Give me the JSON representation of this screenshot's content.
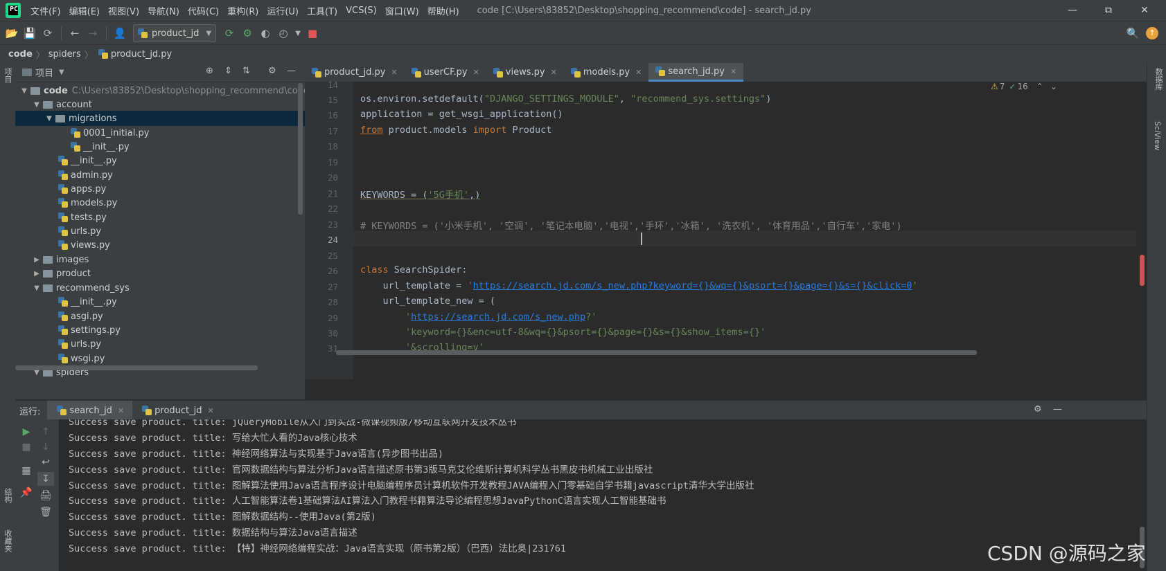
{
  "menu": [
    "文件(F)",
    "编辑(E)",
    "视图(V)",
    "导航(N)",
    "代码(C)",
    "重构(R)",
    "运行(U)",
    "工具(T)",
    "VCS(S)",
    "窗口(W)",
    "帮助(H)"
  ],
  "window_title": "code [C:\\Users\\83852\\Desktop\\shopping_recommend\\code] - search_jd.py",
  "toolbar": {
    "run_config": "product_jd"
  },
  "breadcrumb": [
    "code",
    "spiders",
    "product_jd.py"
  ],
  "left_stripe": {
    "project_label": "项目",
    "structure_label": "结构",
    "favorites_label": "收藏夹"
  },
  "right_stripe": {
    "database_label": "数据库",
    "sciview_label": "SciView"
  },
  "project_panel": {
    "title": "项目",
    "root_name": "code",
    "root_path": "C:\\Users\\83852\\Desktop\\shopping_recommend\\code",
    "tree": [
      "account",
      "migrations",
      "0001_initial.py",
      "__init__.py",
      "__init__.py",
      "admin.py",
      "apps.py",
      "models.py",
      "tests.py",
      "urls.py",
      "views.py",
      "images",
      "product",
      "recommend_sys",
      "__init__.py",
      "asgi.py",
      "settings.py",
      "urls.py",
      "wsgi.py",
      "spiders"
    ]
  },
  "editor_tabs": [
    "product_jd.py",
    "userCF.py",
    "views.py",
    "models.py",
    "search_jd.py"
  ],
  "inspections": {
    "warnings": "7",
    "ok": "16"
  },
  "editor": {
    "line_numbers": [
      "14",
      "15",
      "16",
      "17",
      "18",
      "19",
      "20",
      "21",
      "22",
      "23",
      "24",
      "25",
      "26",
      "27",
      "28",
      "29",
      "30",
      "31"
    ],
    "lines": [
      {
        "plain": ""
      },
      {
        "a": "os.environ.setdefault(",
        "s1": "\"DJANGO_SETTINGS_MODULE\"",
        "b": ", ",
        "s2": "\"recommend_sys.settings\"",
        "c": ")"
      },
      {
        "plain": "application = get_wsgi_application()"
      },
      {
        "kw1": "from",
        "mid": " product.models ",
        "kw2": "import",
        "end": " Product"
      },
      {
        "plain": ""
      },
      {
        "plain": ""
      },
      {
        "plain": ""
      },
      {
        "a": "KEYWORDS = (",
        "s": "'5G手机'",
        "c": ",)"
      },
      {
        "plain": ""
      },
      {
        "comment": "# KEYWORDS = ('小米手机', '空调', '笔记本电脑','电视','手环','冰箱', '洗衣机', '体育用品','自行车','家电')"
      },
      {
        "plain": ""
      },
      {
        "plain": ""
      },
      {
        "kw": "class",
        "rest": " SearchSpider:"
      },
      {
        "a": "    url_template = ",
        "q1": "'",
        "url": "https://search.jd.com/s_new.php?keyword={}&wq={}&psort={}&page={}&s={}&click=0",
        "q2": "'"
      },
      {
        "plain": "    url_template_new = ("
      },
      {
        "q1": "        '",
        "url": "https://search.jd.com/s_new.php",
        "q2": "?'"
      },
      {
        "s": "        'keyword={}&enc=utf-8&wq={}&psort={}&page={}&s={}&show_items={}'"
      },
      {
        "s": "        '&scrolling=y'"
      }
    ]
  },
  "run": {
    "label": "运行:",
    "tabs": [
      "search_jd",
      "product_jd"
    ],
    "output": [
      "Success save product. title: jQueryMobile从入门到实战-微课视频版/移动互联网开发技术丛书",
      "Success save product. title: 写给大忙人看的Java核心技术",
      "Success save product. title: 神经网络算法与实现基于Java语言(异步图书出品)",
      "Success save product. title: 官网数据结构与算法分析Java语言描述原书第3版马克艾伦维斯计算机科学丛书黑皮书机械工业出版社",
      "Success save product. title: 图解算法使用Java语言程序设计电脑编程序员计算机软件开发教程JAVA编程入门零基础自学书籍javascript清华大学出版社",
      "Success save product. title: 人工智能算法卷1基础算法AI算法入门教程书籍算法导论编程思想JavaPythonC语言实现人工智能基础书",
      "Success save product. title: 图解数据结构--使用Java(第2版)",
      "Success save product. title: 数据结构与算法Java语言描述",
      "Success save product. title: 【特】神经网络编程实战：Java语言实现（原书第2版）（巴西）法比奥|231761"
    ]
  },
  "watermark": "CSDN @源码之家"
}
